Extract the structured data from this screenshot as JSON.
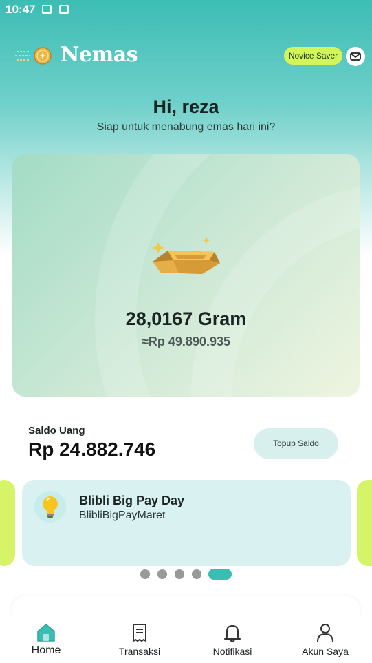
{
  "status_bar": {
    "time": "10:47"
  },
  "header": {
    "brand": "Nemas",
    "level_badge": "Novice Saver"
  },
  "greeting": {
    "title": "Hi, reza",
    "subtitle": "Siap untuk menabung emas hari ini?"
  },
  "gold_card": {
    "grams": "28,0167 Gram",
    "value": "≈Rp 49.890.935"
  },
  "saldo": {
    "label": "Saldo Uang",
    "amount": "Rp 24.882.746",
    "topup_label": "Topup Saldo"
  },
  "promo": {
    "title": "Blibli Big Pay Day",
    "code": "BlibliBigPayMaret",
    "total_slides": 5,
    "active_slide": 5
  },
  "bottom_nav": [
    {
      "label": "Home",
      "icon": "home-icon",
      "active": true
    },
    {
      "label": "Transaksi",
      "icon": "receipt-icon",
      "active": false
    },
    {
      "label": "Notifikasi",
      "icon": "bell-icon",
      "active": false
    },
    {
      "label": "Akun Saya",
      "icon": "user-icon",
      "active": false
    }
  ],
  "colors": {
    "primary": "#3cbdb4",
    "accent": "#d4f55a",
    "promo_bg": "#d9f2f1"
  }
}
